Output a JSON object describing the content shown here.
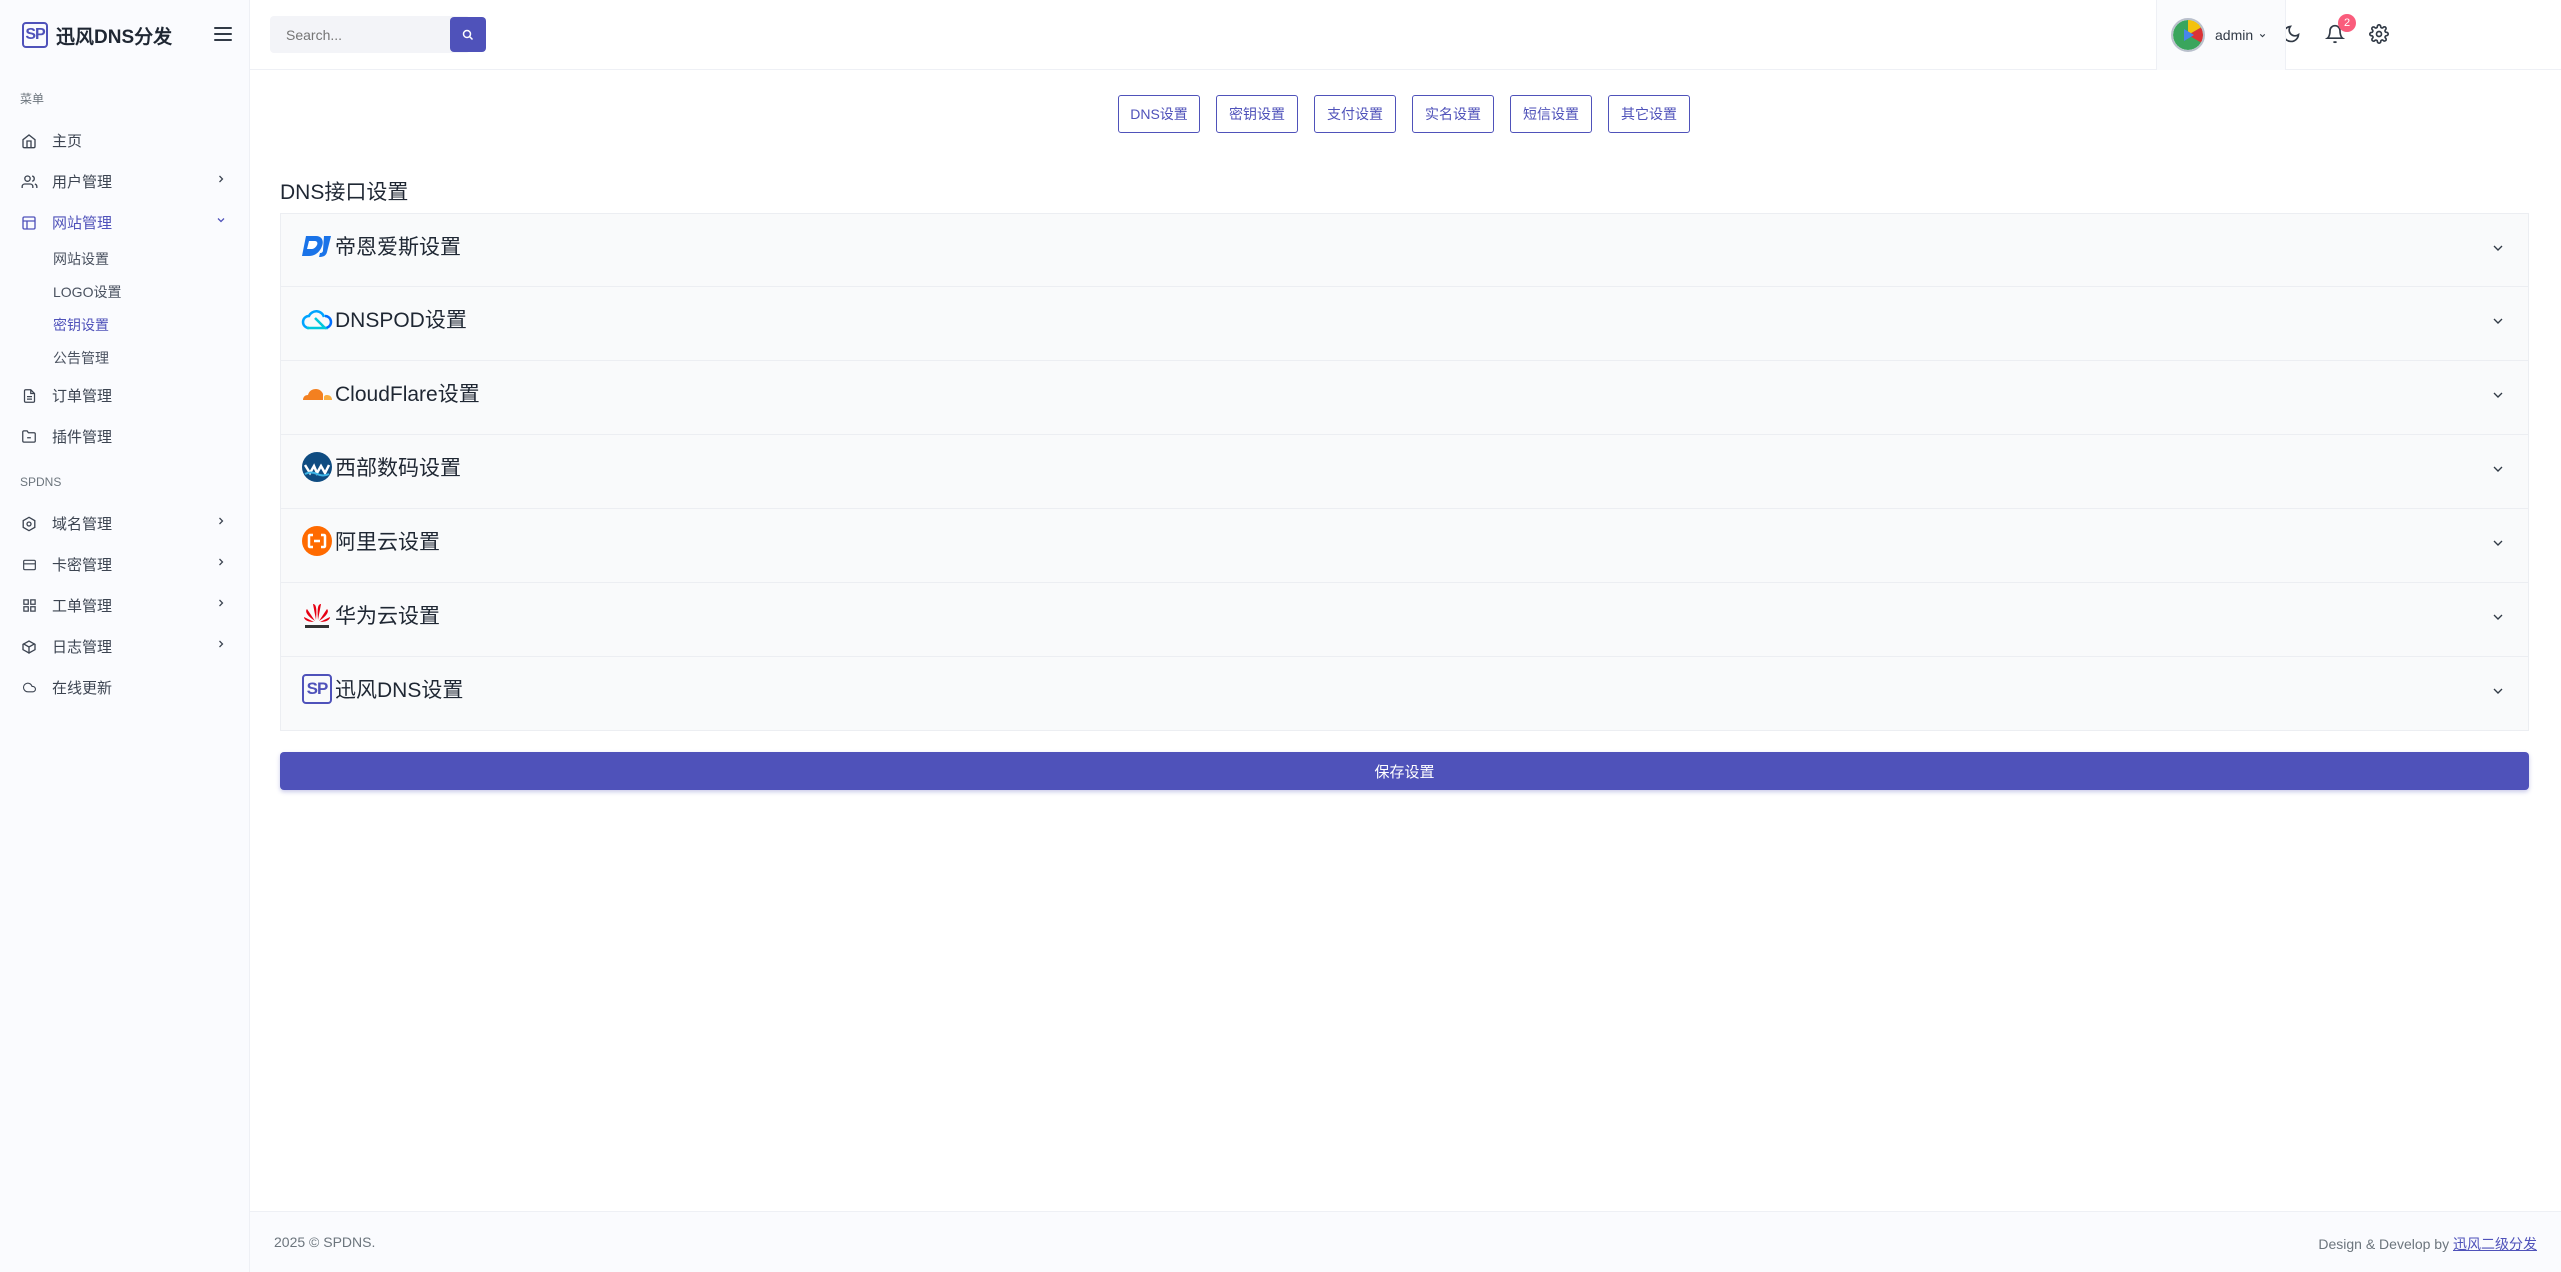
{
  "brand": {
    "logo_text": "SP",
    "name": "迅风DNS分发"
  },
  "sidebar": {
    "section_menu": "菜单",
    "section_spdns": "SPDNS",
    "items": [
      {
        "label": "主页"
      },
      {
        "label": "用户管理"
      },
      {
        "label": "网站管理"
      },
      {
        "label": "订单管理"
      },
      {
        "label": "插件管理"
      }
    ],
    "website_submenu": [
      {
        "label": "网站设置"
      },
      {
        "label": "LOGO设置"
      },
      {
        "label": "密钥设置"
      },
      {
        "label": "公告管理"
      }
    ],
    "spdns_items": [
      {
        "label": "域名管理"
      },
      {
        "label": "卡密管理"
      },
      {
        "label": "工单管理"
      },
      {
        "label": "日志管理"
      },
      {
        "label": "在线更新"
      }
    ]
  },
  "topbar": {
    "search_placeholder": "Search...",
    "notification_count": "2",
    "user_name": "admin"
  },
  "tabs": [
    "DNS设置",
    "密钥设置",
    "支付设置",
    "实名设置",
    "短信设置",
    "其它设置"
  ],
  "section_title": "DNS接口设置",
  "providers": [
    {
      "label": "帝恩爱斯设置",
      "icon": "dnsla-icon"
    },
    {
      "label": "DNSPOD设置",
      "icon": "dnspod-cloud-icon"
    },
    {
      "label": "CloudFlare设置",
      "icon": "cloudflare-icon"
    },
    {
      "label": "西部数码设置",
      "icon": "west-icon"
    },
    {
      "label": "阿里云设置",
      "icon": "aliyun-icon"
    },
    {
      "label": "华为云设置",
      "icon": "huawei-icon"
    },
    {
      "label": "迅风DNS设置",
      "icon": "spdns-icon",
      "logo_text": "SP"
    }
  ],
  "save_label": "保存设置",
  "footer": {
    "copyright": "2025 © SPDNS.",
    "credit_prefix": "Design & Develop by ",
    "credit_link": "迅风二级分发"
  },
  "colors": {
    "primary": "#4f52ba",
    "badge": "#fa5c7c"
  }
}
